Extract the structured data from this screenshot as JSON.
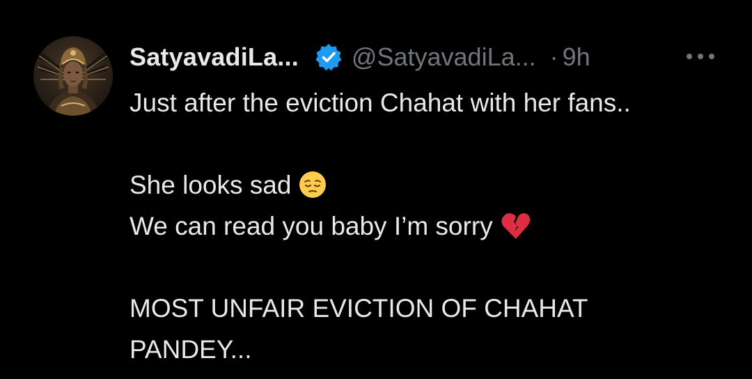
{
  "tweet": {
    "display_name": "SatyavadiLa...",
    "handle": "@SatyavadiLa...",
    "separator": "·",
    "time": "9h",
    "more_icon": "more-horizontal-icon",
    "verified_icon": "verified-badge-icon",
    "verified_color": "#1d9bf0",
    "text_lines": [
      "Just after the eviction Chahat with her fans..",
      "",
      "She looks sad",
      "We can read you baby I’m sorry",
      "",
      "MOST UNFAIR EVICTION OF CHAHAT",
      "PANDEY..."
    ],
    "emojis": {
      "line3": "pensive-face-emoji",
      "line4": "broken-heart-emoji"
    }
  }
}
